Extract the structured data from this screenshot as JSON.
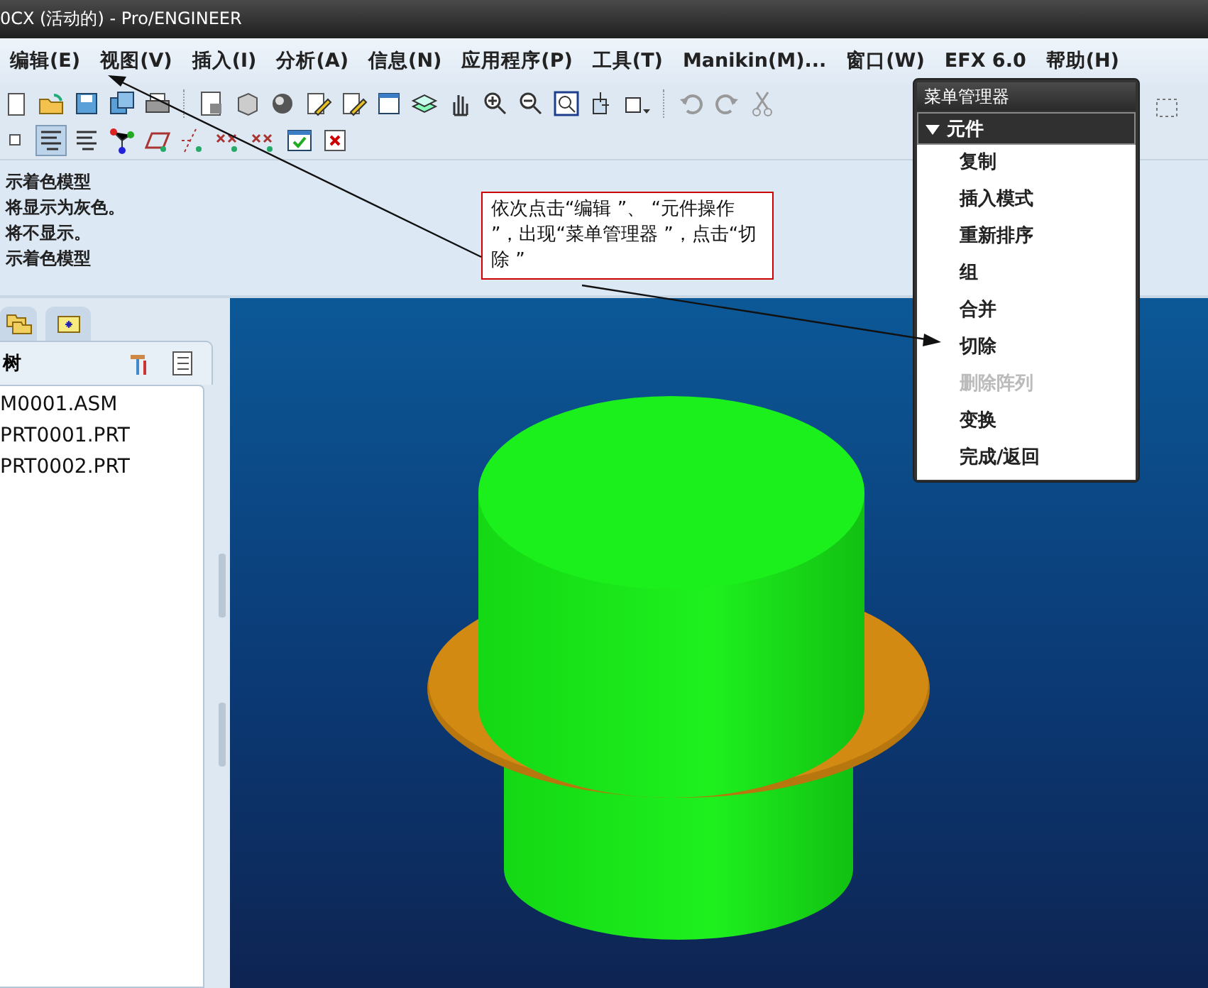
{
  "window": {
    "title": "0CX (活动的) - Pro/ENGINEER"
  },
  "menu_bar": [
    {
      "label": "编辑(E)"
    },
    {
      "label": "视图(V)"
    },
    {
      "label": "插入(I)"
    },
    {
      "label": "分析(A)"
    },
    {
      "label": "信息(N)"
    },
    {
      "label": "应用程序(P)"
    },
    {
      "label": "工具(T)"
    },
    {
      "label": "Manikin(M)..."
    },
    {
      "label": "窗口(W)"
    },
    {
      "label": "EFX 6.0"
    },
    {
      "label": "帮助(H)"
    }
  ],
  "messages": [
    "示着色模型",
    "将显示为灰色。",
    "将不显示。",
    "示着色模型"
  ],
  "model_tree": {
    "title": "树",
    "items": [
      "M0001.ASM",
      "PRT0001.PRT",
      "PRT0002.PRT"
    ]
  },
  "callout": {
    "text": "依次点击“编辑 ”、 “元件操作 ”，出现“菜单管理器 ”，点击“切除 ”"
  },
  "menu_manager": {
    "title": "菜单管理器",
    "section": {
      "label": "元件",
      "expanded": true
    },
    "items": [
      {
        "label": "复制",
        "disabled": false
      },
      {
        "label": "插入模式",
        "disabled": false
      },
      {
        "label": "重新排序",
        "disabled": false
      },
      {
        "label": "组",
        "disabled": false
      },
      {
        "label": "合并",
        "disabled": false
      },
      {
        "label": "切除",
        "disabled": false
      },
      {
        "label": "删除阵列",
        "disabled": true
      },
      {
        "label": "变换",
        "disabled": false
      },
      {
        "label": "完成/返回",
        "disabled": false
      }
    ]
  }
}
